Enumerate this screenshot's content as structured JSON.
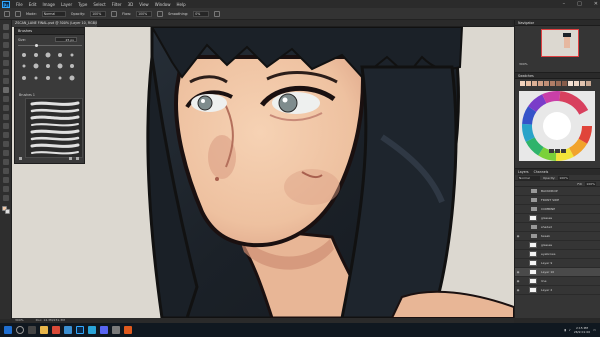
{
  "app": {
    "logo": "Ps",
    "menu": [
      "File",
      "Edit",
      "Image",
      "Layer",
      "Type",
      "Select",
      "Filter",
      "3D",
      "View",
      "Window",
      "Help"
    ]
  },
  "options_bar": {
    "mode_label": "Mode:",
    "mode_value": "Normal",
    "opacity_label": "Opacity:",
    "opacity_value": "100%",
    "flow_label": "Flow:",
    "flow_value": "100%",
    "smoothing_label": "Smoothing:",
    "smoothing_value": "0%"
  },
  "document": {
    "tab_title": "ZSCAN_LANE FINAL.psd @ 300% (Layer 10, RGB/8)",
    "zoom": "300%",
    "doc_size": "Doc: 14.3M/231.3M"
  },
  "brush_panel": {
    "title": "Brushes",
    "size_label": "Size:",
    "size_value": "25 px",
    "folder_label": "Brushes 1"
  },
  "navigator": {
    "title": "Navigator",
    "zoom": "300%"
  },
  "swatches": {
    "title": "Swatches"
  },
  "layers": {
    "tabs": [
      "Layers",
      "Channels"
    ],
    "blend_mode": "Normal",
    "opacity_label": "Opacity:",
    "opacity_value": "100%",
    "fill_label": "Fill:",
    "fill_value": "100%",
    "items": [
      {
        "name": "BACKDROP",
        "type": "folder",
        "visible": false
      },
      {
        "name": "FRONT SIDE",
        "type": "folder",
        "visible": false
      },
      {
        "name": "COMBINE",
        "type": "folder",
        "visible": false
      },
      {
        "name": "glasses",
        "type": "layer",
        "visible": false
      },
      {
        "name": "shaded",
        "type": "folder",
        "visible": false
      },
      {
        "name": "tweak",
        "type": "folder",
        "visible": true
      },
      {
        "name": "glasses",
        "type": "layer",
        "visible": false
      },
      {
        "name": "eyebrows",
        "type": "layer",
        "visible": false
      },
      {
        "name": "Layer 9",
        "type": "layer",
        "visible": false
      },
      {
        "name": "Layer 10",
        "type": "layer",
        "visible": true,
        "selected": true
      },
      {
        "name": "line",
        "type": "layer",
        "visible": true
      },
      {
        "name": "Layer 2",
        "type": "layer",
        "visible": true
      }
    ]
  },
  "taskbar": {
    "time": "2:15 PM",
    "date": "26/9 01:00"
  },
  "colors": {
    "skin": "#f2c9a8",
    "skin_shadow": "#d99b82",
    "hair": "#1b2128",
    "outline": "#1a1010",
    "background": "#dcd8d0",
    "iris": "#7f8c8d",
    "accent": "#31a8ff"
  },
  "icons": {
    "search": "search-icon",
    "windows": "windows-icon"
  }
}
